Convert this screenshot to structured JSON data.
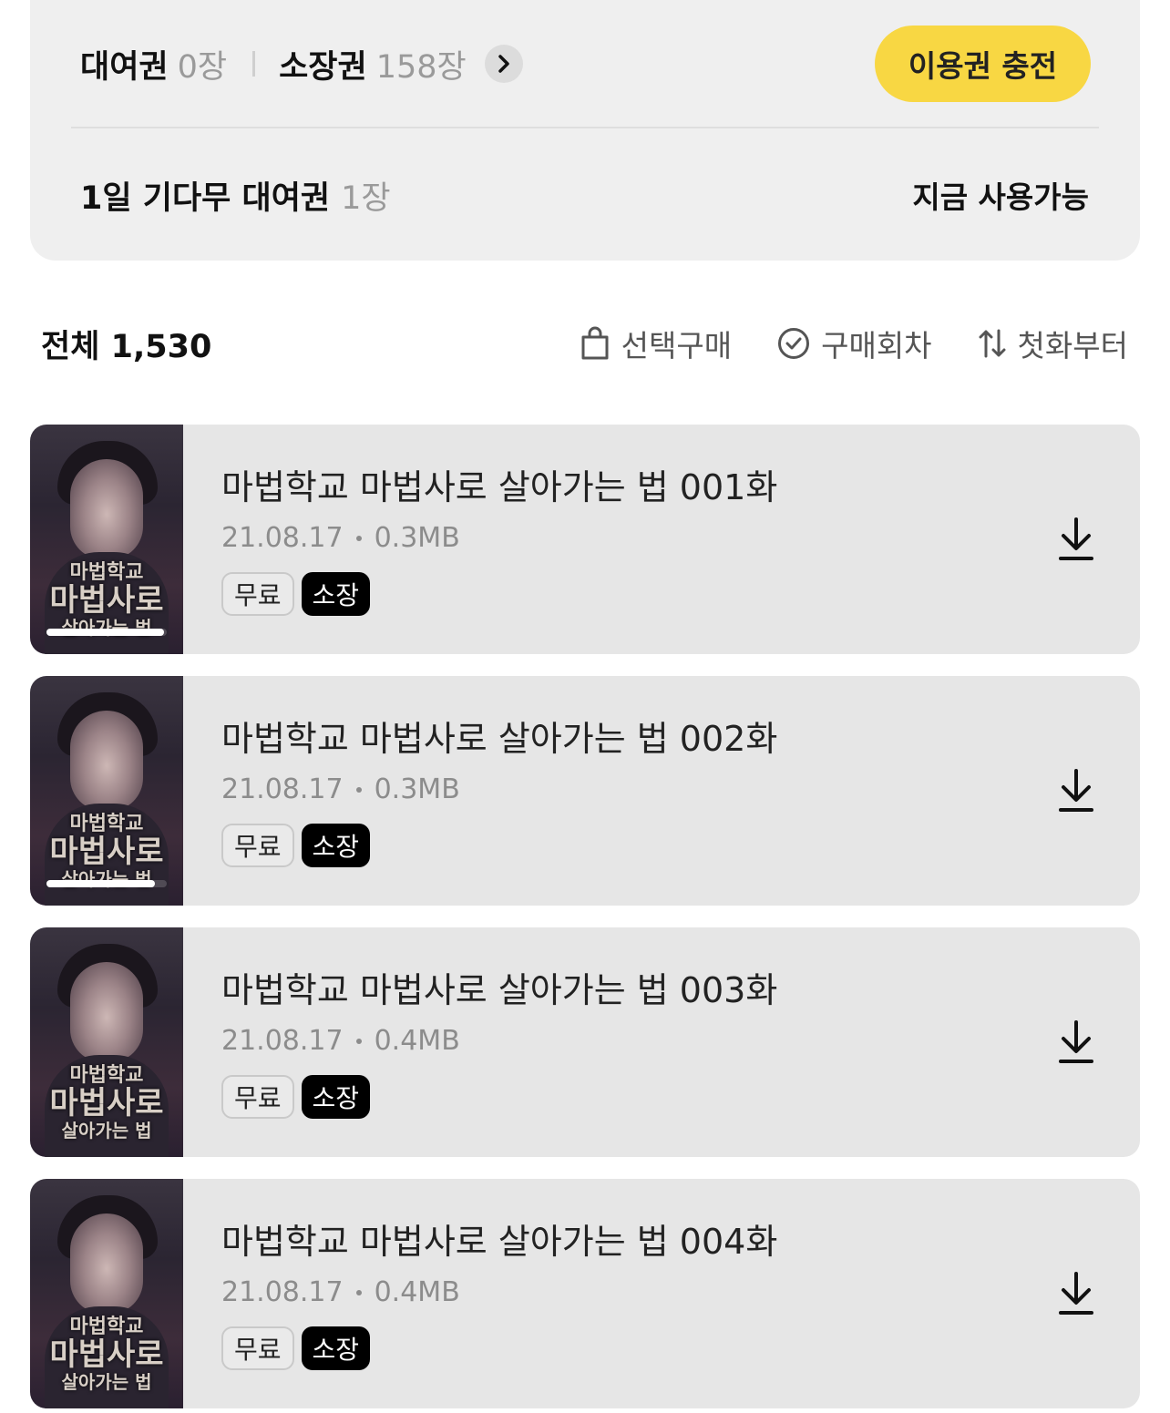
{
  "tickets": {
    "rental_label": "대여권",
    "rental_count": "0장",
    "owned_label": "소장권",
    "owned_count": "158장",
    "charge_label": "이용권 충전",
    "wait_label": "1일 기다무 대여권",
    "wait_count": "1장",
    "wait_status": "지금 사용가능"
  },
  "toolbar": {
    "total_label": "전체 1,530",
    "select_buy_label": "선택구매",
    "purchased_label": "구매회차",
    "sort_label": "첫화부터"
  },
  "thumbnail_text": {
    "line1": "마법학교",
    "line2": "마법사로",
    "line3": "살아가는 법"
  },
  "episodes": [
    {
      "title": "마법학교 마법사로 살아가는 법 001화",
      "date": "21.08.17",
      "size": "0.3MB",
      "free_badge": "무료",
      "owned_badge": "소장",
      "read_progress": 0.98
    },
    {
      "title": "마법학교 마법사로 살아가는 법 002화",
      "date": "21.08.17",
      "size": "0.3MB",
      "free_badge": "무료",
      "owned_badge": "소장",
      "read_progress": 0.9
    },
    {
      "title": "마법학교 마법사로 살아가는 법 003화",
      "date": "21.08.17",
      "size": "0.4MB",
      "free_badge": "무료",
      "owned_badge": "소장",
      "read_progress": 0
    },
    {
      "title": "마법학교 마법사로 살아가는 법 004화",
      "date": "21.08.17",
      "size": "0.4MB",
      "free_badge": "무료",
      "owned_badge": "소장",
      "read_progress": 0
    }
  ],
  "colors": {
    "accent_yellow": "#f8d743",
    "card_bg": "#efefef",
    "row_bg": "#e6e6e6"
  },
  "icons": {
    "more": "chevron-right-icon",
    "select_buy": "shopping-bag-icon",
    "purchased": "check-circle-icon",
    "sort": "sort-arrows-icon",
    "download": "download-icon"
  }
}
